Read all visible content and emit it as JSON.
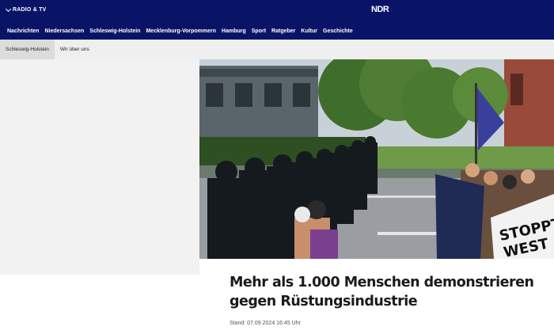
{
  "header": {
    "radio_tv_label": "RADIO & TV",
    "logo_text": "NDR",
    "nav_items": [
      "Nachrichten",
      "Niedersachsen",
      "Schleswig-Holstein",
      "Mecklenburg-Vorpommern",
      "Hamburg",
      "Sport",
      "Ratgeber",
      "Kultur",
      "Geschichte"
    ]
  },
  "subnav": {
    "items": [
      "Schleswig-Holstein",
      "Wir über uns"
    ]
  },
  "article": {
    "title": "Mehr als 1.000 Menschen demonstrieren gegen Rüstungsindustrie",
    "date": "Stand: 07.09.2024 16:45 Uhr",
    "banner_text_1": "STOPPT",
    "banner_text_2": "WEST"
  },
  "colors": {
    "brand_navy": "#0a1467",
    "subnav_bg": "#efefef",
    "left_panel_bg": "#f2f2f2"
  }
}
